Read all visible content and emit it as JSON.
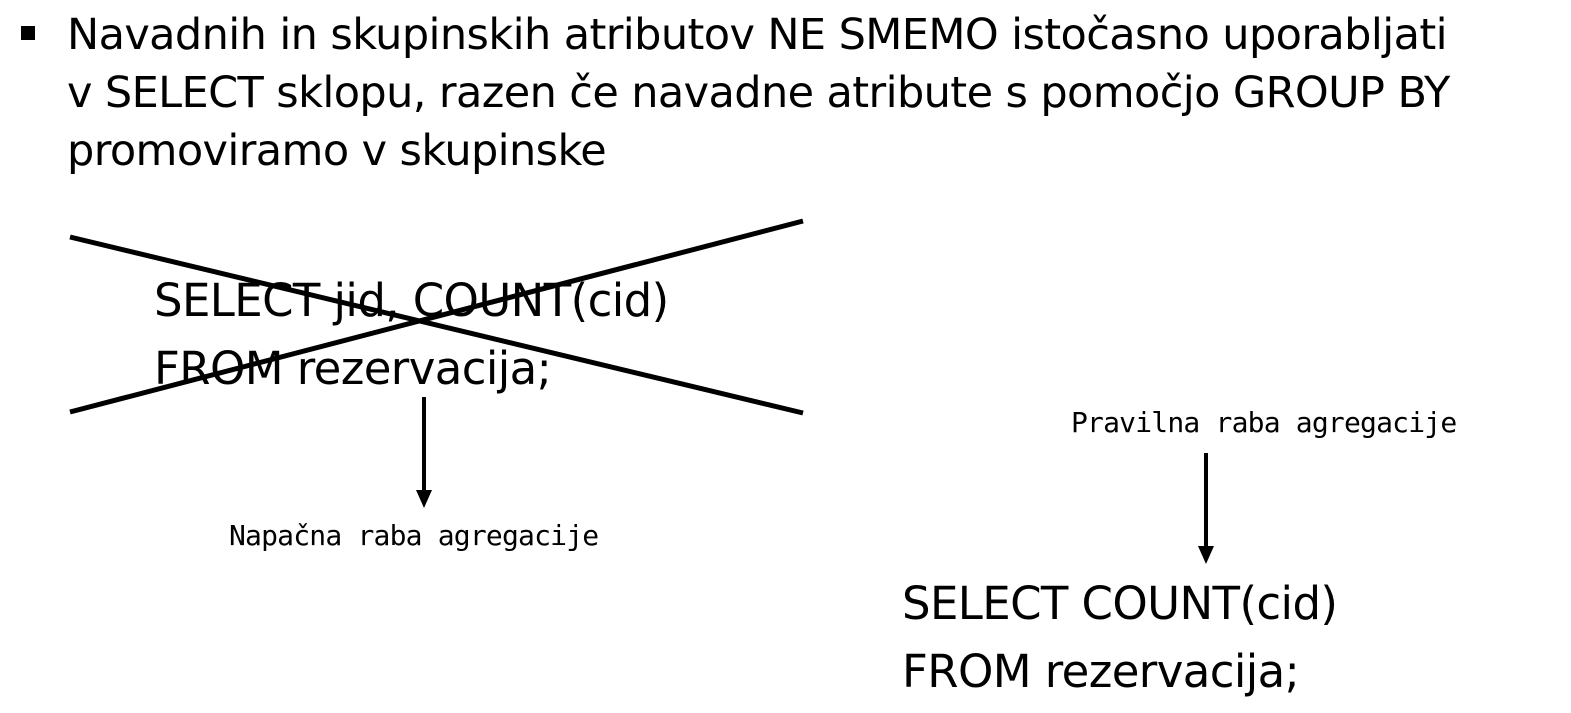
{
  "bullet": {
    "text": "Navadnih in skupinskih atributov NE SMEMO istočasno uporabljati\nv SELECT sklopu, razen če navadne atribute s pomočjo GROUP BY\npromoviramo v skupinske"
  },
  "wrong_example": {
    "lines": [
      "SELECT jid, COUNT(cid)",
      "FROM rezervacija;"
    ],
    "caption": "Napačna raba agregacije"
  },
  "correct_example": {
    "lines": [
      "SELECT COUNT(cid)",
      "FROM rezervacija;"
    ],
    "caption": "Pravilna raba agregacije"
  },
  "colors": {
    "text": "#000000",
    "background": "#ffffff"
  }
}
